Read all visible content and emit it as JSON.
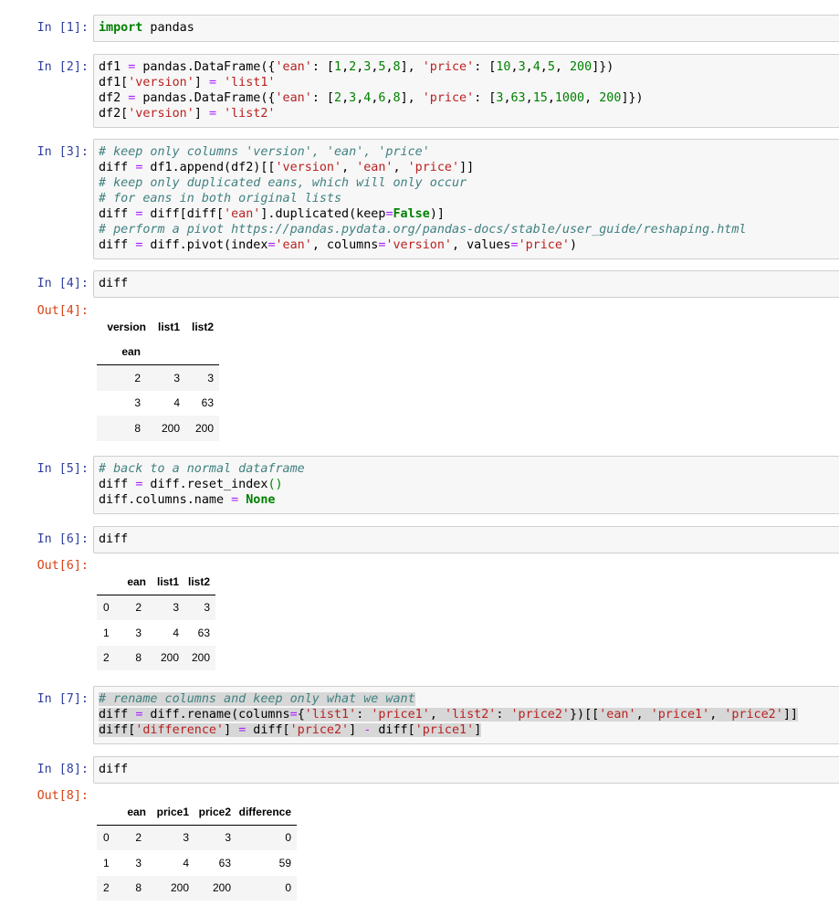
{
  "cells": [
    {
      "in_prompt": "In [1]:"
    },
    {
      "in_prompt": "In [2]:"
    },
    {
      "in_prompt": "In [3]:"
    },
    {
      "in_prompt": "In [4]:",
      "code": "diff",
      "out_prompt": "Out[4]:"
    },
    {
      "in_prompt": "In [5]:"
    },
    {
      "in_prompt": "In [6]:",
      "code": "diff",
      "out_prompt": "Out[6]:"
    },
    {
      "in_prompt": "In [7]:"
    },
    {
      "in_prompt": "In [8]:",
      "code": "diff",
      "out_prompt": "Out[8]:"
    }
  ],
  "code_tokens": {
    "c1_kw": "import",
    "c1_rest": " pandas",
    "c2_l1a": "df1 ",
    "c2_l1b": "=",
    "c2_l1c": " pandas.DataFrame({",
    "c2_l1d": "'ean'",
    "c2_l1e": ": [",
    "c2_l1f": "1",
    "c2_l1g": ",",
    "c2_l1h": "2",
    "c2_l1i": ",",
    "c2_l1j": "3",
    "c2_l1k": ",",
    "c2_l1l": "5",
    "c2_l1m": ",",
    "c2_l1n": "8",
    "c2_l1o": "], ",
    "c2_l1p": "'price'",
    "c2_l1q": ": [",
    "c2_l1r": "10",
    "c2_l1s": ",",
    "c2_l1t": "3",
    "c2_l1u": ",",
    "c2_l1v": "4",
    "c2_l1w": ",",
    "c2_l1x": "5",
    "c2_l1y": ", ",
    "c2_l1z": "200",
    "c2_l1end": "]})",
    "c2_l2a": "df1[",
    "c2_l2b": "'version'",
    "c2_l2c": "] ",
    "c2_l2d": "=",
    "c2_l2e": " ",
    "c2_l2f": "'list1'",
    "c2_l3a": "df2 ",
    "c2_l3b": "=",
    "c2_l3c": " pandas.DataFrame({",
    "c2_l3d": "'ean'",
    "c2_l3e": ": [",
    "c2_l3f": "2",
    "c2_l3g": ",",
    "c2_l3h": "3",
    "c2_l3i": ",",
    "c2_l3j": "4",
    "c2_l3k": ",",
    "c2_l3l": "6",
    "c2_l3m": ",",
    "c2_l3n": "8",
    "c2_l3o": "], ",
    "c2_l3p": "'price'",
    "c2_l3q": ": [",
    "c2_l3r": "3",
    "c2_l3s": ",",
    "c2_l3t": "63",
    "c2_l3u": ",",
    "c2_l3v": "15",
    "c2_l3w": ",",
    "c2_l3x": "1000",
    "c2_l3y": ", ",
    "c2_l3z": "200",
    "c2_l3end": "]})",
    "c2_l4a": "df2[",
    "c2_l4b": "'version'",
    "c2_l4c": "] ",
    "c2_l4d": "=",
    "c2_l4e": " ",
    "c2_l4f": "'list2'",
    "c3_l1": "# keep only columns 'version', 'ean', 'price'",
    "c3_l2a": "diff ",
    "c3_l2b": "=",
    "c3_l2c": " df1.append(df2)[[",
    "c3_l2d": "'version'",
    "c3_l2e": ", ",
    "c3_l2f": "'ean'",
    "c3_l2g": ", ",
    "c3_l2h": "'price'",
    "c3_l2i": "]]",
    "c3_l3": "# keep only duplicated eans, which will only occur",
    "c3_l4": "# for eans in both original lists",
    "c3_l5a": "diff ",
    "c3_l5b": "=",
    "c3_l5c": " diff[diff[",
    "c3_l5d": "'ean'",
    "c3_l5e": "].duplicated(keep",
    "c3_l5f": "=",
    "c3_l5g": "False",
    "c3_l5h": ")]",
    "c3_l6": "# perform a pivot https://pandas.pydata.org/pandas-docs/stable/user_guide/reshaping.html",
    "c3_l7a": "diff ",
    "c3_l7b": "=",
    "c3_l7c": " diff.pivot(index",
    "c3_l7d": "=",
    "c3_l7e": "'ean'",
    "c3_l7f": ", columns",
    "c3_l7g": "=",
    "c3_l7h": "'version'",
    "c3_l7i": ", values",
    "c3_l7j": "=",
    "c3_l7k": "'price'",
    "c3_l7l": ")",
    "c5_l1": "# back to a normal dataframe",
    "c5_l2a": "diff ",
    "c5_l2b": "=",
    "c5_l2c": " diff.reset_index",
    "c5_l2d": "()",
    "c5_l3a": "diff.columns.name ",
    "c5_l3b": "=",
    "c5_l3c": " ",
    "c5_l3d": "None",
    "c7_l1": "# rename columns and keep only what we want",
    "c7_l2a": "diff ",
    "c7_l2b": "=",
    "c7_l2c": " diff.rename(columns",
    "c7_l2d": "=",
    "c7_l2e": "{",
    "c7_l2f": "'list1'",
    "c7_l2g": ": ",
    "c7_l2h": "'price1'",
    "c7_l2i": ", ",
    "c7_l2j": "'list2'",
    "c7_l2k": ": ",
    "c7_l2l": "'price2'",
    "c7_l2m": "})[[",
    "c7_l2n": "'ean'",
    "c7_l2o": ", ",
    "c7_l2p": "'price1'",
    "c7_l2q": ", ",
    "c7_l2r": "'price2'",
    "c7_l2s": "]]",
    "c7_l3a": "diff[",
    "c7_l3b": "'difference'",
    "c7_l3c": "] ",
    "c7_l3d": "=",
    "c7_l3e": " diff[",
    "c7_l3f": "'price2'",
    "c7_l3g": "] ",
    "c7_l3h": "-",
    "c7_l3i": " diff[",
    "c7_l3j": "'price1'",
    "c7_l3k": "]"
  },
  "outputs": {
    "out4": {
      "columns_name": "version",
      "columns": [
        "list1",
        "list2"
      ],
      "index_name": "ean",
      "rows": [
        {
          "index": "2",
          "values": [
            "3",
            "3"
          ]
        },
        {
          "index": "3",
          "values": [
            "4",
            "63"
          ]
        },
        {
          "index": "8",
          "values": [
            "200",
            "200"
          ]
        }
      ]
    },
    "out6": {
      "columns": [
        "ean",
        "list1",
        "list2"
      ],
      "rows": [
        {
          "index": "0",
          "values": [
            "2",
            "3",
            "3"
          ]
        },
        {
          "index": "1",
          "values": [
            "3",
            "4",
            "63"
          ]
        },
        {
          "index": "2",
          "values": [
            "8",
            "200",
            "200"
          ]
        }
      ]
    },
    "out8": {
      "columns": [
        "ean",
        "price1",
        "price2",
        "difference"
      ],
      "rows": [
        {
          "index": "0",
          "values": [
            "2",
            "3",
            "3",
            "0"
          ]
        },
        {
          "index": "1",
          "values": [
            "3",
            "4",
            "63",
            "59"
          ]
        },
        {
          "index": "2",
          "values": [
            "8",
            "200",
            "200",
            "0"
          ]
        }
      ]
    }
  }
}
